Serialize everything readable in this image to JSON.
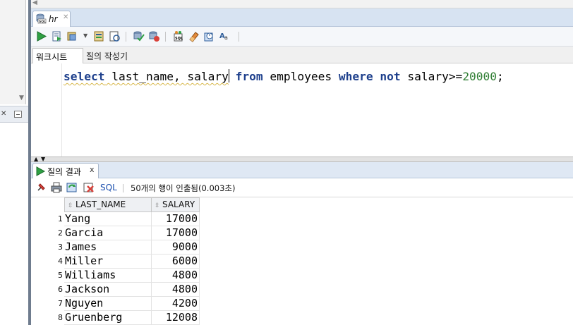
{
  "editor_tab": {
    "label": "hr"
  },
  "sub_tabs": {
    "worksheet": "워크시트",
    "query_builder": "질의 작성기"
  },
  "code": {
    "select": "select",
    "cols": " last_name, salary",
    "from": "from",
    "table": " employees ",
    "where": "where",
    "not": "not",
    "cond": " salary>=",
    "value": "20000",
    "end": ";"
  },
  "result_tab": {
    "label": "질의 결과",
    "close": "x"
  },
  "result_toolbar": {
    "sql_label": "SQL",
    "status": "50개의 행이 인출됨(0.003초)"
  },
  "grid": {
    "columns": [
      "LAST_NAME",
      "SALARY"
    ],
    "rows": [
      {
        "n": "1",
        "name": "Yang",
        "salary": "17000"
      },
      {
        "n": "2",
        "name": "Garcia",
        "salary": "17000"
      },
      {
        "n": "3",
        "name": "James",
        "salary": "9000"
      },
      {
        "n": "4",
        "name": "Miller",
        "salary": "6000"
      },
      {
        "n": "5",
        "name": "Williams",
        "salary": "4800"
      },
      {
        "n": "6",
        "name": "Jackson",
        "salary": "4800"
      },
      {
        "n": "7",
        "name": "Nguyen",
        "salary": "4200"
      },
      {
        "n": "8",
        "name": "Gruenberg",
        "salary": "12008"
      }
    ]
  },
  "colors": {
    "keyword": "#1d3f8c",
    "number": "#2e7d32",
    "link": "#1b4fae"
  }
}
